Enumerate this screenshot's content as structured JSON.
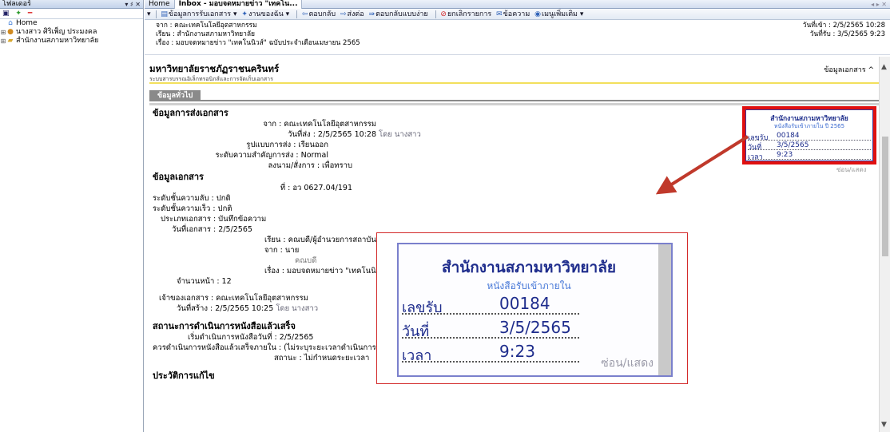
{
  "folder_pane": {
    "title": "โฟลเดอร์",
    "controls": "▾ ♯ ✕",
    "tools": [
      "▣",
      "✦",
      "━"
    ],
    "tree": [
      {
        "label": "Home"
      },
      {
        "label": "นางสาว ศิริเพ็ญ ประมงคล"
      },
      {
        "label": "สำนักงานสภามหาวิทยาลัย"
      }
    ]
  },
  "tabs": {
    "items": [
      {
        "label": "Home"
      },
      {
        "label": "Inbox - มอบจดหมายข่าว \"เทคโน..."
      }
    ],
    "controls": "◂ ▸ ✕"
  },
  "toolbar": {
    "items": [
      {
        "label": "ข้อมูลการรับเอกสาร ▾"
      },
      {
        "label": "งานของฉัน ▾"
      },
      {
        "label": "ตอบกลับ"
      },
      {
        "label": "ส่งต่อ"
      },
      {
        "label": "ตอบกลับแบบง่าย"
      },
      {
        "label": "ยกเลิกรายการ"
      },
      {
        "label": "ข้อความ"
      },
      {
        "label": "เมนูเพิ่มเติม ▾"
      }
    ]
  },
  "header": {
    "from": "จาก : คณะเทคโนโลยีอุตสาหกรรม",
    "to": "เรียน : สำนักงานสภามหาวิทยาลัย",
    "subject": "เรื่อง : มอบจดหมายข่าว \"เทคโนนิวส์\" ฉบับประจำเดือนเมษายน 2565",
    "date_in": "วันที่เข้า : 2/5/2565 10:28",
    "date_received": "วันที่รับ : 3/5/2565 9:23"
  },
  "document": {
    "org_name": "มหาวิทยาลัยราชภัฏราชนครินทร์",
    "org_sub": "ระบบสารบรรณอิเล็กทรอนิกส์และการจัดเก็บเอกสาร",
    "info_link": "ข้อมูลเอกสาร ^",
    "tab_general": "ข้อมูลทั่วไป",
    "send_section": {
      "title": "ข้อมูลการส่งเอกสาร",
      "from": "จาก : คณะเทคโนโลยีอุตสาหกรรม",
      "sent_date": "วันที่ส่ง : 2/5/2565 10:28",
      "sent_by": "โดย นางสาว",
      "send_type": "รูปแบบการส่ง : เรียนออก",
      "importance": "ระดับความสำคัญการส่ง : Normal",
      "order": "ลงนาม/สั่งการ : เพื่อทราบ"
    },
    "doc_section": {
      "title": "ข้อมูลเอกสาร",
      "number": "ที่ : อว 0627.04/191",
      "secrecy": "ระดับชั้นความลับ : ปกติ",
      "urgency": "ระดับชั้นความเร็ว : ปกติ",
      "doc_type": "ประเภทเอกสาร : บันทึกข้อความ",
      "doc_date": "วันที่เอกสาร : 2/5/2565",
      "to": "เรียน : คณบดี/ผู้อำนวยการสถาบัน ศูนย์ สำนัก",
      "from": "จาก : นาย",
      "from_sub": "คณบดี",
      "subject": "เรื่อง : มอบจดหมายข่าว \"เทคโนนิวส์\" ฉบับประจำเดือ",
      "pages": "จำนวนหน้า : 12",
      "owner": "เจ้าของเอกสาร : คณะเทคโนโลยีอุตสาหกรรม",
      "created": "วันที่สร้าง : 2/5/2565 10:25",
      "created_by": "โดย นางสาว"
    },
    "status_section": {
      "title": "สถานะการดำเนินการหนังสือแล้วเสร็จ",
      "start": "เริ่มดำเนินการหนังสือวันที่ : 2/5/2565",
      "deadline": "ควรดำเนินการหนังสือแล้วเสร็จภายใน : (ไม่ระบุระยะเวลาดำเนินการหนังสือ)",
      "status": "สถานะ : ไม่กำหนดระยะเวลา"
    },
    "history_title": "ประวัติการแก้ไข"
  },
  "stamp": {
    "title": "สำนักงานสภามหาวิทยาลัย",
    "subtitle": "หนังสือรับเข้าภายใน ปี 2565",
    "rows": [
      {
        "key": "เลขรับ",
        "value": "00184"
      },
      {
        "key": "วันที่",
        "value": "3/5/2565"
      },
      {
        "key": "เวลา",
        "value": "9:23"
      }
    ],
    "hidden_link": "ซ่อน/แสดง"
  },
  "zoom": {
    "title": "สำนักงานสภามหาวิทยาลัย",
    "subtitle": "หนังสือรับเข้าภายใน",
    "rows": [
      {
        "key": "เลขรับ",
        "value": "00184"
      },
      {
        "key": "วันที่",
        "value": "3/5/2565"
      },
      {
        "key": "เวลา",
        "value": "9:23"
      }
    ],
    "toggle": "ซ่อน/แสดง"
  },
  "colors": {
    "highlight": "#e01010",
    "accent": "#1e2c8c"
  }
}
